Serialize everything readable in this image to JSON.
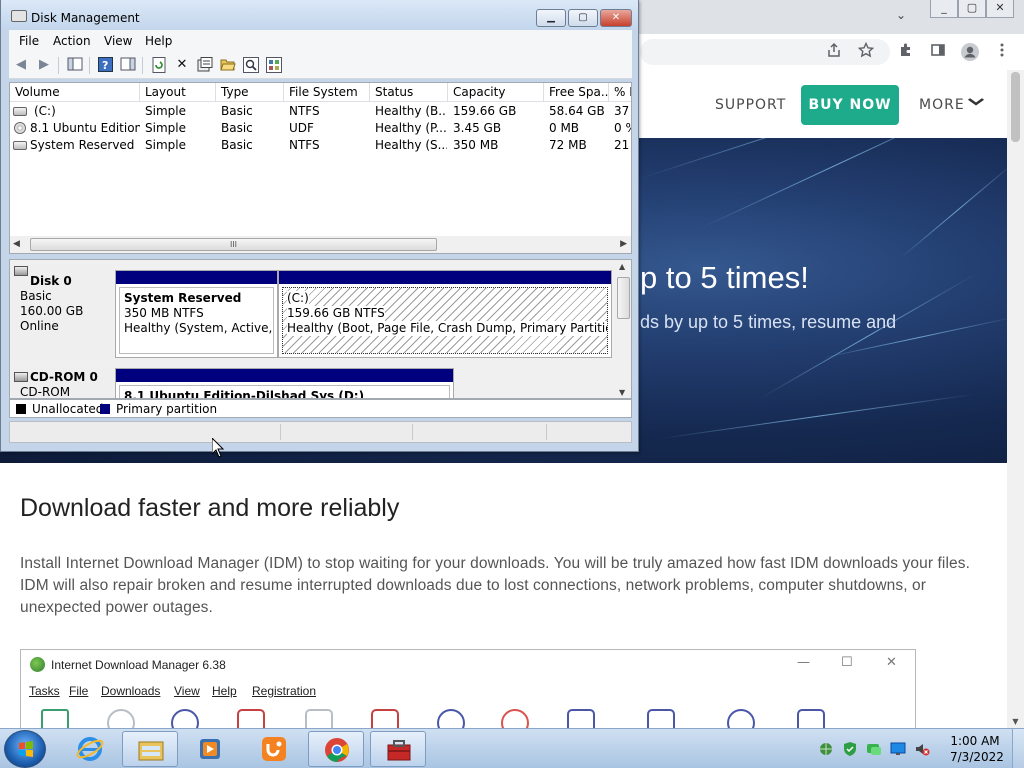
{
  "browser": {
    "window_buttons": [
      "_",
      "▢",
      "✕"
    ],
    "tab_dropdown": "⌄",
    "toolbar_icons": [
      "share-icon",
      "star-icon",
      "extensions-icon",
      "sidebar-icon",
      "profile-icon",
      "menu-icon"
    ]
  },
  "site": {
    "nav": {
      "support": "SUPPORT",
      "buy_now": "BUY NOW",
      "more": "MORE",
      "accent": "#1eab8b"
    },
    "hero": {
      "title": "p to 5 times!",
      "subtitle": "ds by up to 5 times, resume and"
    },
    "heading": "Download faster and more reliably",
    "paragraph": "Install Internet Download Manager (IDM) to stop waiting for your downloads. You will be truly amazed how fast IDM downloads your files. IDM will also repair broken and resume interrupted downloads due to lost connections, network problems, computer shutdowns, or unexpected power outages.",
    "idm_window": {
      "title": "Internet Download Manager 6.38",
      "menus": [
        "Tasks",
        "File",
        "Downloads",
        "View",
        "Help",
        "Registration"
      ]
    }
  },
  "disk_management": {
    "title": "Disk Management",
    "menus": [
      "File",
      "Action",
      "View",
      "Help"
    ],
    "columns": [
      "Volume",
      "Layout",
      "Type",
      "File System",
      "Status",
      "Capacity",
      "Free Spa...",
      "% F"
    ],
    "rows": [
      [
        "(C:)",
        "Simple",
        "Basic",
        "NTFS",
        "Healthy (B...",
        "159.66 GB",
        "58.64 GB",
        "37"
      ],
      [
        "8.1 Ubuntu Edition...",
        "Simple",
        "Basic",
        "UDF",
        "Healthy (P...",
        "3.45 GB",
        "0 MB",
        "0 %"
      ],
      [
        "System Reserved",
        "Simple",
        "Basic",
        "NTFS",
        "Healthy (S...",
        "350 MB",
        "72 MB",
        "21"
      ]
    ],
    "scroll_grip": "III",
    "disks": [
      {
        "name": "Disk 0",
        "type": "Basic",
        "size": "160.00 GB",
        "state": "Online",
        "partitions": [
          {
            "name": "System Reserved",
            "size": "350 MB NTFS",
            "status": "Healthy (System, Active, Primary Partition)"
          },
          {
            "name": "(C:)",
            "size": "159.66 GB NTFS",
            "status": "Healthy (Boot, Page File, Crash Dump, Primary Partition)"
          }
        ]
      },
      {
        "name": "CD-ROM 0",
        "type": "CD-ROM",
        "partitions": [
          {
            "name": "8.1 Ubuntu Edition-Dilshad Sys  (D:)"
          }
        ]
      }
    ],
    "legend": [
      {
        "label": "Unallocated",
        "color": "#000000"
      },
      {
        "label": "Primary partition",
        "color": "#00007f"
      }
    ]
  },
  "taskbar": {
    "pinned": [
      "internet-explorer",
      "windows-explorer",
      "media-player",
      "uc-browser",
      "chrome",
      "toolbox"
    ],
    "clock": {
      "time": "1:00 AM",
      "date": "7/3/2022"
    }
  }
}
